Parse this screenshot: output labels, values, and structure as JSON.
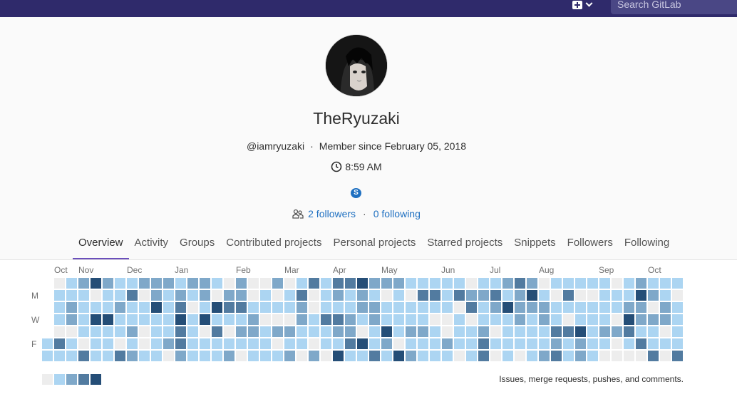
{
  "topbar": {
    "search_placeholder": "Search GitLab",
    "new_menu_icon": "plus-square-icon",
    "new_menu_caret": "chevron-down-icon"
  },
  "profile": {
    "name": "TheRyuzaki",
    "username": "@iamryuzaki",
    "separator": "·",
    "member_since": "Member since February 05, 2018",
    "local_time": "8:59 AM",
    "skype_icon": "skype-icon",
    "followers_link": "2 followers",
    "following_link": "0 following"
  },
  "tabs": [
    {
      "label": "Overview",
      "active": true
    },
    {
      "label": "Activity",
      "active": false
    },
    {
      "label": "Groups",
      "active": false
    },
    {
      "label": "Contributed projects",
      "active": false
    },
    {
      "label": "Personal projects",
      "active": false
    },
    {
      "label": "Starred projects",
      "active": false
    },
    {
      "label": "Snippets",
      "active": false
    },
    {
      "label": "Followers",
      "active": false
    },
    {
      "label": "Following",
      "active": false
    }
  ],
  "calendar": {
    "months": [
      "Oct",
      "Nov",
      "Dec",
      "Jan",
      "Feb",
      "Mar",
      "Apr",
      "May",
      "Jun",
      "Jul",
      "Aug",
      "Sep",
      "Oct"
    ],
    "day_labels": [
      "M",
      "W",
      "F"
    ],
    "legend_text": "Issues, merge requests, pushes, and comments.",
    "colors": [
      "#ededed",
      "#acd5f2",
      "#7fa8c9",
      "#527ba0",
      "#254e77"
    ]
  }
}
